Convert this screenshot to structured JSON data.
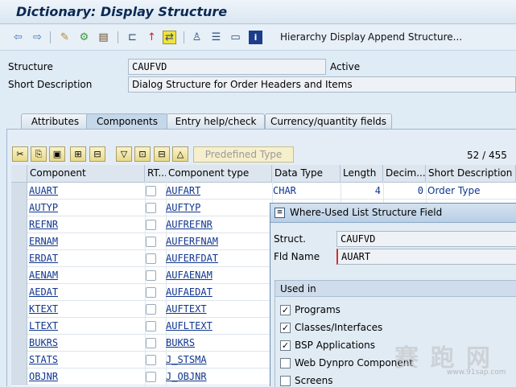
{
  "window": {
    "title": "Dictionary: Display Structure"
  },
  "toolbar": {
    "icons": [
      "back-arrow-icon",
      "forward-arrow-icon",
      "display-change-icon",
      "activate-icon",
      "check-icon",
      "where-used-icon",
      "object-list-icon",
      "active-inactive-icon",
      "hierarchy-icon",
      "other-object-icon",
      "print-icon",
      "info-icon"
    ],
    "hierarchy_display": "Hierarchy Display",
    "append_structure": "Append Structure..."
  },
  "header": {
    "structure_label": "Structure",
    "structure_value": "CAUFVD",
    "status": "Active",
    "short_desc_label": "Short Description",
    "short_desc_value": "Dialog Structure for Order Headers and Items"
  },
  "tabs": [
    {
      "label": "Attributes",
      "active": false
    },
    {
      "label": "Components",
      "active": true
    },
    {
      "label": "Entry help/check",
      "active": false
    },
    {
      "label": "Currency/quantity fields",
      "active": false
    }
  ],
  "components_toolbar": {
    "predefined_type": "Predefined Type",
    "row_position": "52",
    "row_separator": "/",
    "row_total": "455"
  },
  "table": {
    "columns": [
      "Component",
      "RT...",
      "Component type",
      "Data Type",
      "Length",
      "Decim...",
      "Short Description"
    ],
    "rows": [
      {
        "component": "AUART",
        "type": "AUFART",
        "data_type": "CHAR",
        "length": "4",
        "decimals": "0",
        "desc": "Order Type"
      },
      {
        "component": "AUTYP",
        "type": "AUFTYP"
      },
      {
        "component": "REFNR",
        "type": "AUFREFNR"
      },
      {
        "component": "ERNAM",
        "type": "AUFERFNAM"
      },
      {
        "component": "ERDAT",
        "type": "AUFERFDAT"
      },
      {
        "component": "AENAM",
        "type": "AUFAENAM"
      },
      {
        "component": "AEDAT",
        "type": "AUFAEDAT"
      },
      {
        "component": "KTEXT",
        "type": "AUFTEXT"
      },
      {
        "component": "LTEXT",
        "type": "AUFLTEXT"
      },
      {
        "component": "BUKRS",
        "type": "BUKRS"
      },
      {
        "component": "STATS",
        "type": "J_STSMA"
      },
      {
        "component": "OBJNR",
        "type": "J_OBJNR"
      }
    ]
  },
  "dialog": {
    "title": "Where-Used List Structure Field",
    "struct_label": "Struct.",
    "struct_value": "CAUFVD",
    "field_label": "Fld Name",
    "field_value": "AUART",
    "group_title": "Used in",
    "options": [
      {
        "label": "Programs",
        "checked": true
      },
      {
        "label": "Classes/Interfaces",
        "checked": true
      },
      {
        "label": "BSP Applications",
        "checked": true
      },
      {
        "label": "Web Dynpro Component",
        "checked": false
      },
      {
        "label": "Screens",
        "checked": false
      }
    ]
  },
  "watermark": {
    "text": "赛 跑 网",
    "url": "www.91sap.com"
  },
  "colors": {
    "link": "#10368f",
    "accent_yellow": "#f6efcc",
    "panel": "#e4edf6"
  }
}
